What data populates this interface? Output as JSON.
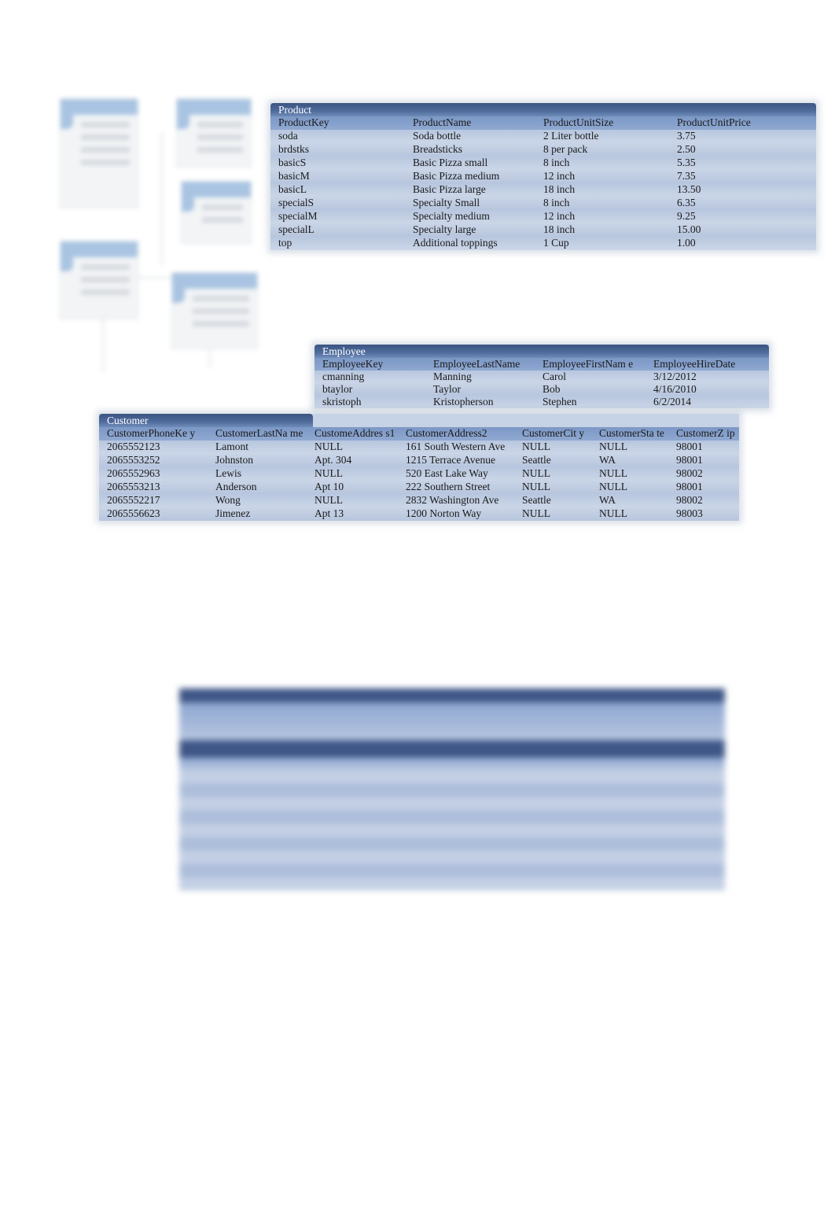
{
  "product": {
    "title": "Product",
    "columns": [
      "ProductKey",
      "ProductName",
      "ProductUnitSize",
      "ProductUnitPrice"
    ],
    "rows": [
      [
        "soda",
        "Soda bottle",
        "2 Liter bottle",
        "3.75"
      ],
      [
        "brdstks",
        "Breadsticks",
        "8 per pack",
        "2.50"
      ],
      [
        "basicS",
        "Basic Pizza small",
        "8 inch",
        "5.35"
      ],
      [
        "basicM",
        "Basic Pizza medium",
        "12 inch",
        "7.35"
      ],
      [
        "basicL",
        "Basic Pizza large",
        "18 inch",
        "13.50"
      ],
      [
        "specialS",
        "Specialty Small",
        "8 inch",
        "6.35"
      ],
      [
        "specialM",
        "Specialty medium",
        "12 inch",
        "9.25"
      ],
      [
        "specialL",
        "Specialty large",
        "18 inch",
        "15.00"
      ],
      [
        "top",
        "Additional toppings",
        "1 Cup",
        "1.00"
      ]
    ]
  },
  "employee": {
    "title": "Employee",
    "columns": [
      "EmployeeKey",
      "EmployeeLastName",
      "EmployeeFirstNam e",
      "EmployeeHireDate"
    ],
    "rows": [
      [
        "cmanning",
        "Manning",
        "Carol",
        "3/12/2012"
      ],
      [
        "btaylor",
        "Taylor",
        "Bob",
        "4/16/2010"
      ],
      [
        "skristoph",
        "Kristopherson",
        "Stephen",
        "6/2/2014"
      ]
    ]
  },
  "customer": {
    "title": "Customer",
    "columns": [
      "CustomerPhoneKe y",
      "CustomerLastNa me",
      "CustomeAddres s1",
      "CustomerAddress2",
      "CustomerCit y",
      "CustomerSta te",
      "CustomerZ ip"
    ],
    "rows": [
      [
        "2065552123",
        "Lamont",
        "NULL",
        "161 South Western Ave",
        "NULL",
        "NULL",
        "98001"
      ],
      [
        "2065553252",
        "Johnston",
        "Apt. 304",
        "1215 Terrace Avenue",
        "Seattle",
        "WA",
        "98001"
      ],
      [
        "2065552963",
        "Lewis",
        "NULL",
        "520 East Lake Way",
        "NULL",
        "NULL",
        "98002"
      ],
      [
        "2065553213",
        "Anderson",
        "Apt 10",
        "222 Southern Street",
        "NULL",
        "NULL",
        "98001"
      ],
      [
        "2065552217",
        "Wong",
        "NULL",
        "2832 Washington Ave",
        "Seattle",
        "WA",
        "98002"
      ],
      [
        "2065556623",
        "Jimenez",
        "Apt 13",
        "1200 Norton Way",
        "NULL",
        "NULL",
        "98003"
      ]
    ]
  },
  "colors": {
    "table_title": "#3b5482",
    "header_row": "#8fa8d1",
    "row_light": "#cbd6e7",
    "row_dark": "#b7c6de"
  }
}
